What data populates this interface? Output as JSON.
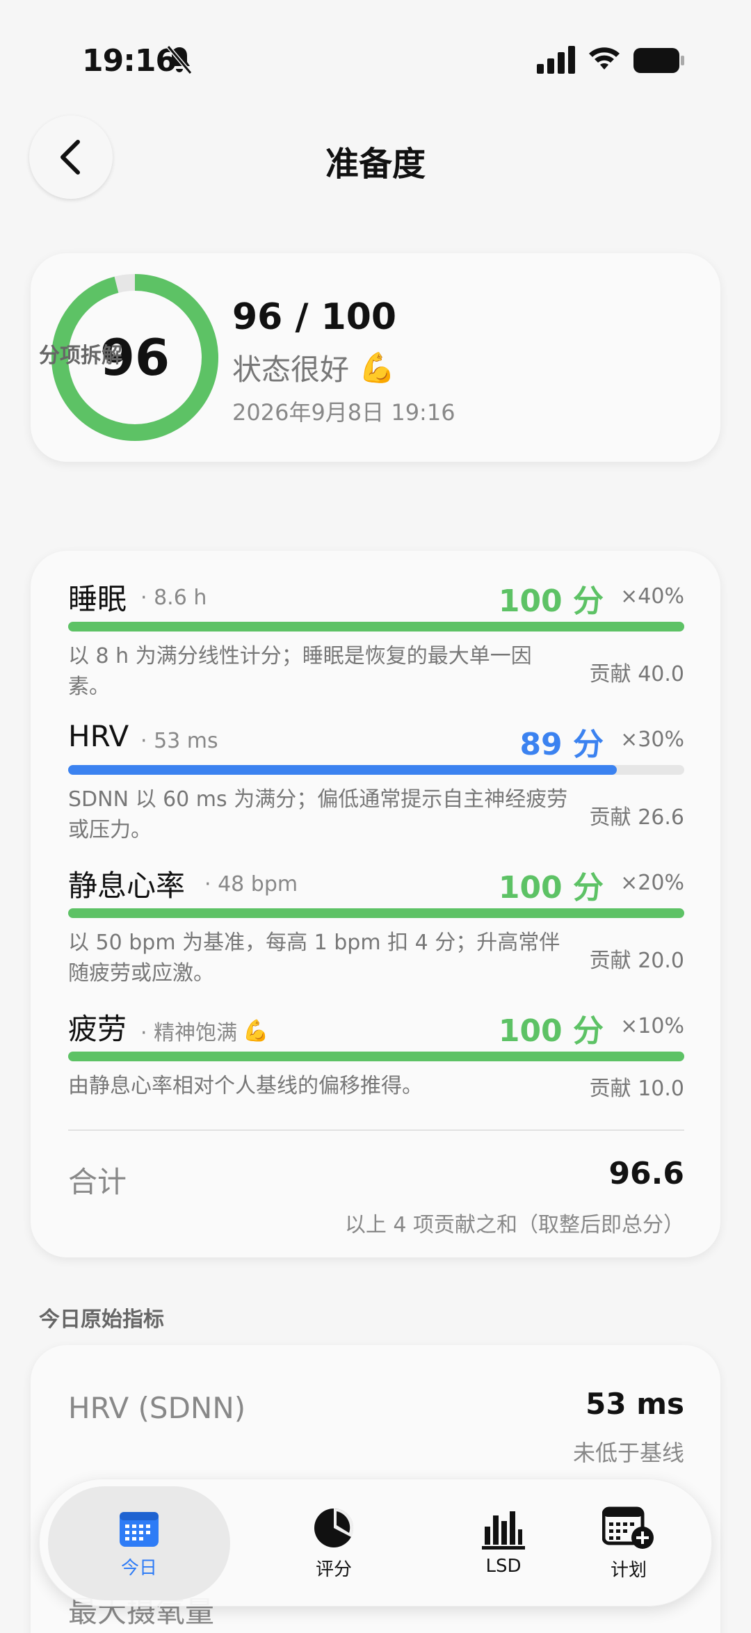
{
  "status_bar": {
    "time": "19:16"
  },
  "header": {
    "title": "准备度"
  },
  "summary": {
    "ring_value": "96",
    "score_fraction": 0.96,
    "score_text": "96 / 100",
    "status_text": "状态很好",
    "status_emoji": "💪",
    "datetime": "2026年9月8日 19:16"
  },
  "breakdown": {
    "section_label": "分项拆解",
    "items": [
      {
        "name": "睡眠",
        "meta": "· 8.6 h",
        "score": "100 分",
        "weight": "×40%",
        "fraction": 1.0,
        "color": "#5dc265",
        "desc": "以 8 h 为满分线性计分；睡眠是恢复的最大单一因素。",
        "contribution": "贡献 40.0"
      },
      {
        "name": "HRV",
        "meta": "· 53 ms",
        "score": "89 分",
        "weight": "×30%",
        "fraction": 0.89,
        "color": "#3b82f0",
        "desc": "SDNN 以 60 ms 为满分；偏低通常提示自主神经疲劳或压力。",
        "contribution": "贡献 26.6"
      },
      {
        "name": "静息心率",
        "meta": "· 48 bpm",
        "score": "100 分",
        "weight": "×20%",
        "fraction": 1.0,
        "color": "#5dc265",
        "desc": "以 50 bpm 为基准，每高 1 bpm 扣 4 分；升高常伴随疲劳或应激。",
        "contribution": "贡献 20.0"
      },
      {
        "name": "疲劳",
        "meta": "· 精神饱满",
        "meta_emoji": "💪",
        "score": "100 分",
        "weight": "×10%",
        "fraction": 1.0,
        "color": "#5dc265",
        "desc": "由静息心率相对个人基线的偏移推得。",
        "contribution": "贡献 10.0"
      }
    ],
    "total_label": "合计",
    "total_value": "96.6",
    "total_note": "以上 4 项贡献之和（取整后即总分）"
  },
  "raw": {
    "section_label": "今日原始指标",
    "hrv_label": "HRV (SDNN)",
    "hrv_value": "53 ms",
    "hrv_note": "未低于基线",
    "vo2_label": "最大摄氧量"
  },
  "tabbar": {
    "tabs": [
      {
        "label": "今日",
        "icon": "calendar-icon",
        "active": true
      },
      {
        "label": "评分",
        "icon": "pie-chart-icon",
        "active": false
      },
      {
        "label": "LSD",
        "icon": "bar-chart-icon",
        "active": false
      },
      {
        "label": "计划",
        "icon": "calendar-add-icon",
        "active": false
      }
    ]
  },
  "colors": {
    "green": "#5dc265",
    "blue": "#3b82f0",
    "tab_active": "#2e7cf6"
  }
}
